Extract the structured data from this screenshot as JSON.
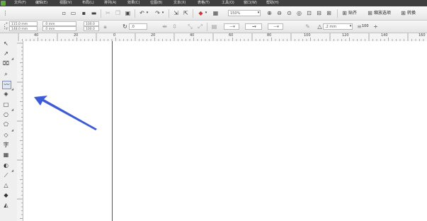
{
  "menubar": {
    "items": [
      {
        "label": "文件(F)"
      },
      {
        "label": "编辑(E)"
      },
      {
        "label": "视图(V)"
      },
      {
        "label": "布局(L)"
      },
      {
        "label": "排列(A)"
      },
      {
        "label": "效果(C)"
      },
      {
        "label": "位图(B)"
      },
      {
        "label": "文本(X)"
      },
      {
        "label": "表格(T)"
      },
      {
        "label": "工具(O)"
      },
      {
        "label": "窗口(W)"
      },
      {
        "label": "帮助(H)"
      }
    ]
  },
  "toolbar": {
    "zoom_value": "150%",
    "snap_label": "贴齐",
    "dynamic_guides_label": "缩放选项",
    "convert_label": "转换"
  },
  "propertybar": {
    "x_value": "115.0 mm",
    "y_value": "148.0 mm",
    "w_value": ".0 mm",
    "h_value": ".0 mm",
    "scale_x": "100.0",
    "scale_y": "100.0",
    "rotation": ".0",
    "outline_width": ".2 mm",
    "line_style_value": "100"
  },
  "ruler": {
    "h_labels": [
      "40",
      "20",
      "0",
      "20",
      "40",
      "60",
      "80",
      "100",
      "120",
      "140",
      "160",
      "180"
    ],
    "v_labels": [
      "",
      "",
      "",
      "",
      "",
      "",
      ""
    ]
  },
  "colors": {
    "menubar_bg": "#3f3f3f",
    "arrow": "#3d5bd6",
    "page_edge": "#555555"
  }
}
